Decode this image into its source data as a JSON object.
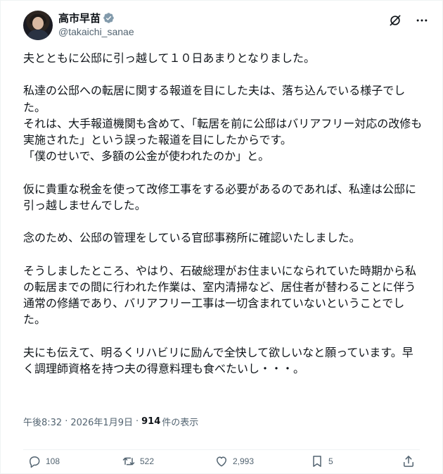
{
  "author": {
    "display_name": "高市早苗",
    "username": "@takaichi_sanae"
  },
  "icons": {
    "avatar": "profile-photo",
    "verified": "verified-badge-icon",
    "grok": "grok-icon",
    "more": "more-dots-icon",
    "reply": "reply-icon",
    "retweet": "retweet-icon",
    "like": "heart-icon",
    "bookmark": "bookmark-icon",
    "share": "share-icon"
  },
  "colors": {
    "text": "#0f1419",
    "secondary": "#536471",
    "border": "#eff3f4"
  },
  "post": {
    "text": "夫とともに公邸に引っ越して１０日あまりとなりました。\n\n私達の公邸への転居に関する報道を目にした夫は、落ち込んでいる様子でした。\nそれは、大手報道機関も含めて、「転居を前に公邸はバリアフリー対応の改修も実施された」という誤った報道を目にしたからです。\n「僕のせいで、多額の公金が使われたのか」と。\n\n仮に貴重な税金を使って改修工事をする必要があるのであれば、私達は公邸に引っ越しませんでした。\n\n念のため、公邸の管理をしている官邸事務所に確認いたしました。\n\nそうしましたところ、やはり、石破総理がお住まいになられていた時期から私の転居までの間に行われた作業は、室内清掃など、居住者が替わることに伴う通常の修繕であり、バリアフリー工事は一切含まれていないということでした。\n\n夫にも伝えて、明るくリハビリに励んで全快して欲しいなと願っています。早く調理師資格を持つ夫の得意料理も食べたいし・・・。"
  },
  "meta": {
    "time": "午後8:32",
    "separator1": "·",
    "date": "2026年1月9日",
    "separator2": "·",
    "views_count": "914",
    "views_label": "件の表示"
  },
  "actions": {
    "reply_count": "108",
    "retweet_count": "522",
    "like_count": "2,993",
    "bookmark_count": "5"
  }
}
